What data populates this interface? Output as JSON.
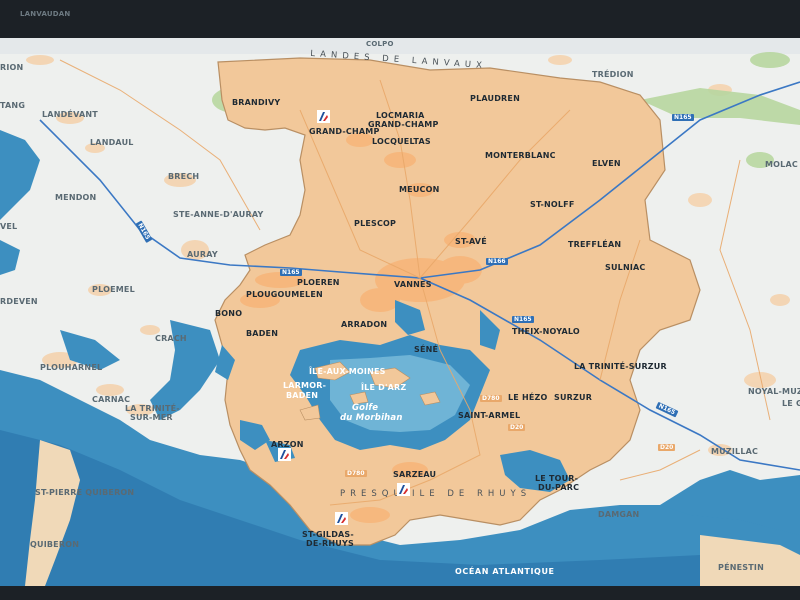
{
  "map": {
    "region_labels": {
      "landes_de_lanvaux": "LANDES DE LANVAUX",
      "presquile_de_rhuys": "PRESQU'ILE DE RHUYS"
    },
    "water_labels": {
      "golfe_du_morbihan_line1": "Golfe",
      "golfe_du_morbihan_line2": "du Morbihan",
      "ocean_atlantique": "OCÉAN ATLANTIQUE"
    },
    "roads": {
      "n165_north": "N165",
      "n165_auray": "N165",
      "n165_west": "N165",
      "n166": "N166",
      "n165_east": "N165",
      "n165_se": "N165",
      "d20": "D20",
      "d780": "D780",
      "d780b": "D780",
      "d780c": "D20"
    },
    "places": {
      "brandivy": "BRANDIVY",
      "grand_champ": "GRAND-CHAMP",
      "locmaria_1": "LOCMARIA",
      "locmaria_2": "GRAND-CHAMP",
      "plaudren": "PLAUDREN",
      "locqueltas": "LOCQUELTAS",
      "monterblanc": "MONTERBLANC",
      "elven": "ELVEN",
      "meucon": "MEUCON",
      "st_nolff": "ST-NOLFF",
      "plescop": "PLESCOP",
      "st_ave": "ST-AVÉ",
      "trefflean": "TREFFLÉAN",
      "sulniac": "SULNIAC",
      "ploeren": "PLOEREN",
      "vannes": "VANNES",
      "plougoumelen": "PLOUGOUMELEN",
      "bono": "BONO",
      "theix_noyalo": "THEIX-NOYALO",
      "baden": "BADEN",
      "arradon": "ARRADON",
      "sene": "SÉNÉ",
      "la_trinite_surzur": "LA TRINITÉ-SURZUR",
      "ile_aux_moines": "ÎLE-AUX-MOINES",
      "ile_d_arz": "ÎLE D'ARZ",
      "larmor_baden_1": "LARMOR-",
      "larmor_baden_2": "BADEN",
      "le_hezo": "LE HÉZO",
      "surzur": "SURZUR",
      "saint_armel": "SAINT-ARMEL",
      "arzon": "ARZON",
      "sarzeau": "SARZEAU",
      "le_tour_du_parc_1": "LE TOUR-",
      "le_tour_du_parc_2": "DU-PARC",
      "st_gildas_1": "ST-GILDAS-",
      "st_gildas_2": "DE-RHUYS"
    },
    "outside_places": {
      "landevant": "LANDÉVANT",
      "landaul": "LANDAUL",
      "brech": "BRECH",
      "mendon": "MENDON",
      "ste_anne": "STE-ANNE-D'AURAY",
      "auray": "AURAY",
      "ploemel": "PLOEMEL",
      "crach": "CRACH",
      "plouharnel": "PLOUHARNEL",
      "carnac": "CARNAC",
      "la_trinite_1": "LA TRINITÉ-",
      "la_trinite_2": "SUR-MER",
      "st_pierre": "ST-PIERRE QUIBERON",
      "quiberon": "QUIBERON",
      "molac": "MOLAC",
      "noyal_muz": "NOYAL-MUZ",
      "le_g": "LE G",
      "muzillac": "MUZILLAC",
      "damgan": "DAMGAN",
      "penestin": "PÉNESTIN",
      "tredion": "TRÉDION",
      "colpo": "COLPO",
      "lanvaudan": "LANVAUDAN",
      "rion": "RION",
      "etang": "TANG",
      "erdeven": "RDEVEN",
      "evel": "VEL"
    },
    "colors": {
      "sea": "#3d8fc0",
      "sea_light": "#6fb4d6",
      "land_outside": "#eef0ee",
      "territory": "#f2c89a",
      "forest": "#b8d7a0",
      "roads_main": "#3b78c4",
      "frame": "#1c2126"
    },
    "icons": [
      "harbor-logo-icon"
    ]
  }
}
